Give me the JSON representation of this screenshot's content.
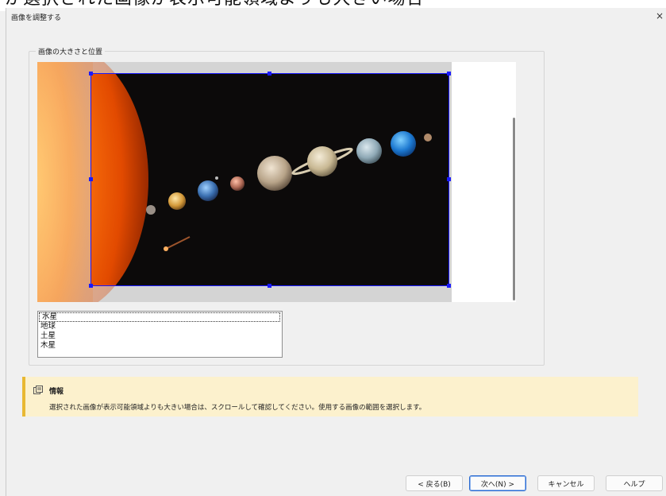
{
  "background_text": "が選択された画像が表示可能領域よりも大きい場合",
  "dialog": {
    "title": "画像を調整する",
    "close_glyph": "×"
  },
  "group": {
    "label": "画像の大きさと位置"
  },
  "preview": {
    "image_description_icon": "solar-system-image"
  },
  "list": {
    "items": [
      "水星",
      "地球",
      "土星",
      "木星"
    ],
    "selected_index": 0
  },
  "info": {
    "icon": "info-panel-icon",
    "title": "情報",
    "text": "選択された画像が表示可能領域よりも大きい場合は、スクロールして確認してください。使用する画像の範囲を選択します。"
  },
  "buttons": {
    "back": "< 戻る(B)",
    "next": "次へ(N) >",
    "cancel": "キャンセル",
    "help": "ヘルプ"
  },
  "colors": {
    "selection_handle": "#1a1aff",
    "info_background": "#fcf1cd",
    "info_accent": "#e8b833",
    "primary_button_border": "#2a6ad0"
  }
}
